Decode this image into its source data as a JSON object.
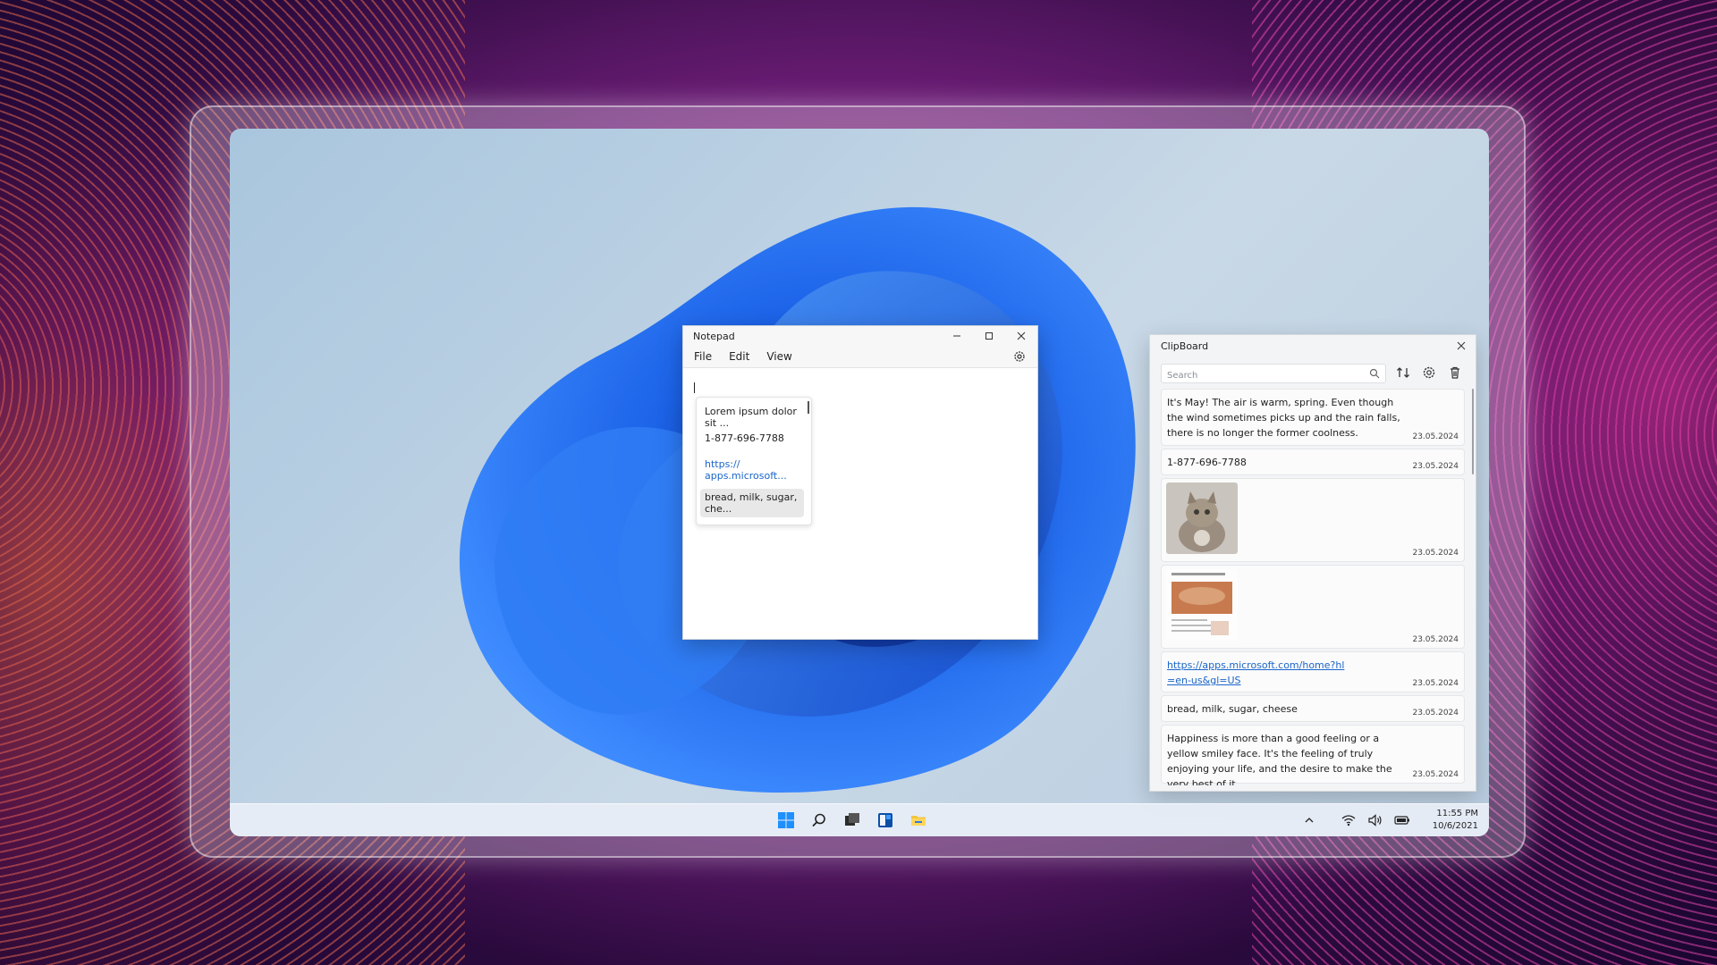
{
  "notepad": {
    "title": "Notepad",
    "menu": [
      "File",
      "Edit",
      "View"
    ],
    "suggestions": [
      "Lorem ipsum dolor sit ...",
      "1-877-696-7788",
      "https:// apps.microsoft...",
      "bread, milk, sugar, che..."
    ]
  },
  "clipboard": {
    "title": "ClipBoard",
    "search_placeholder": "Search",
    "items": [
      {
        "type": "text",
        "text": "It's May! The air is warm, spring. Even though the wind sometimes picks up and the rain falls, there is no longer the former coolness.",
        "date": "23.05.2024"
      },
      {
        "type": "text",
        "text": "1-877-696-7788",
        "date": "23.05.2024"
      },
      {
        "type": "image",
        "image": "kitten-photo",
        "date": "23.05.2024"
      },
      {
        "type": "image",
        "image": "document-page-thumbnail",
        "date": "23.05.2024"
      },
      {
        "type": "link",
        "text": "https://apps.microsoft.com/home?hl=en-us&gl=US",
        "date": "23.05.2024"
      },
      {
        "type": "text",
        "text": "bread, milk, sugar, cheese",
        "date": "23.05.2024"
      },
      {
        "type": "text",
        "text": "Happiness is more than a good feeling or a yellow smiley face. It's the feeling of truly enjoying your life, and the desire to make the very best of it.",
        "date": "23.05.2024"
      }
    ]
  },
  "taskbar": {
    "icons": [
      "windows-start-icon",
      "search-icon",
      "task-view-icon",
      "widgets-icon",
      "file-explorer-icon"
    ],
    "tray": [
      "chevron-up-icon",
      "wifi-icon",
      "volume-icon",
      "battery-icon"
    ],
    "time": "11:55 PM",
    "date": "10/6/2021"
  },
  "colors": {
    "accent": "#0067c0",
    "link": "#1a66c9",
    "bloom": "#1e6ef0"
  }
}
